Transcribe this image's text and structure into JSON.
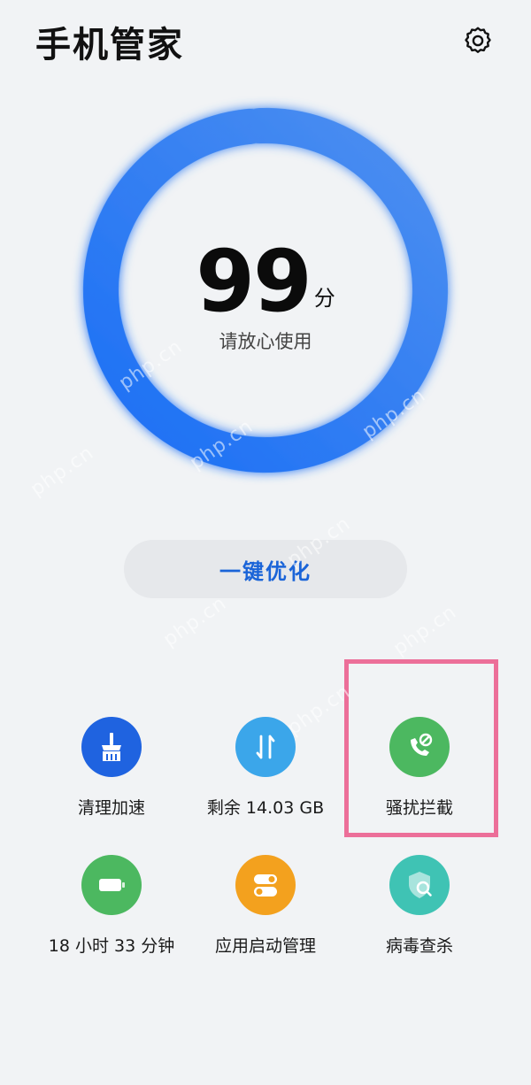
{
  "header": {
    "title": "手机管家",
    "settings_icon": "gear-icon"
  },
  "score": {
    "value": "99",
    "unit": "分",
    "status": "请放心使用",
    "fill": 0.99
  },
  "optimize_label": "一键优化",
  "tools": [
    {
      "label": "清理加速",
      "icon": "broom-icon",
      "color": "#1f63e0"
    },
    {
      "label": "剩余 14.03 GB",
      "icon": "transfer-arrows-icon",
      "color": "#3ba6ea"
    },
    {
      "label": "骚扰拦截",
      "icon": "phone-block-icon",
      "color": "#4cb860"
    },
    {
      "label": "18 小时 33 分钟",
      "icon": "battery-icon",
      "color": "#4cb860"
    },
    {
      "label": "应用启动管理",
      "icon": "toggle-switch-icon",
      "color": "#f3a11e"
    },
    {
      "label": "病毒查杀",
      "icon": "shield-search-icon",
      "color": "#3fc3b4"
    }
  ],
  "watermark": "php.cn",
  "colors": {
    "ring_start": "#1b6ff5",
    "ring_end": "#4d8ff0",
    "ring_track": "#8db8f7",
    "highlight": "#ec6f99"
  }
}
